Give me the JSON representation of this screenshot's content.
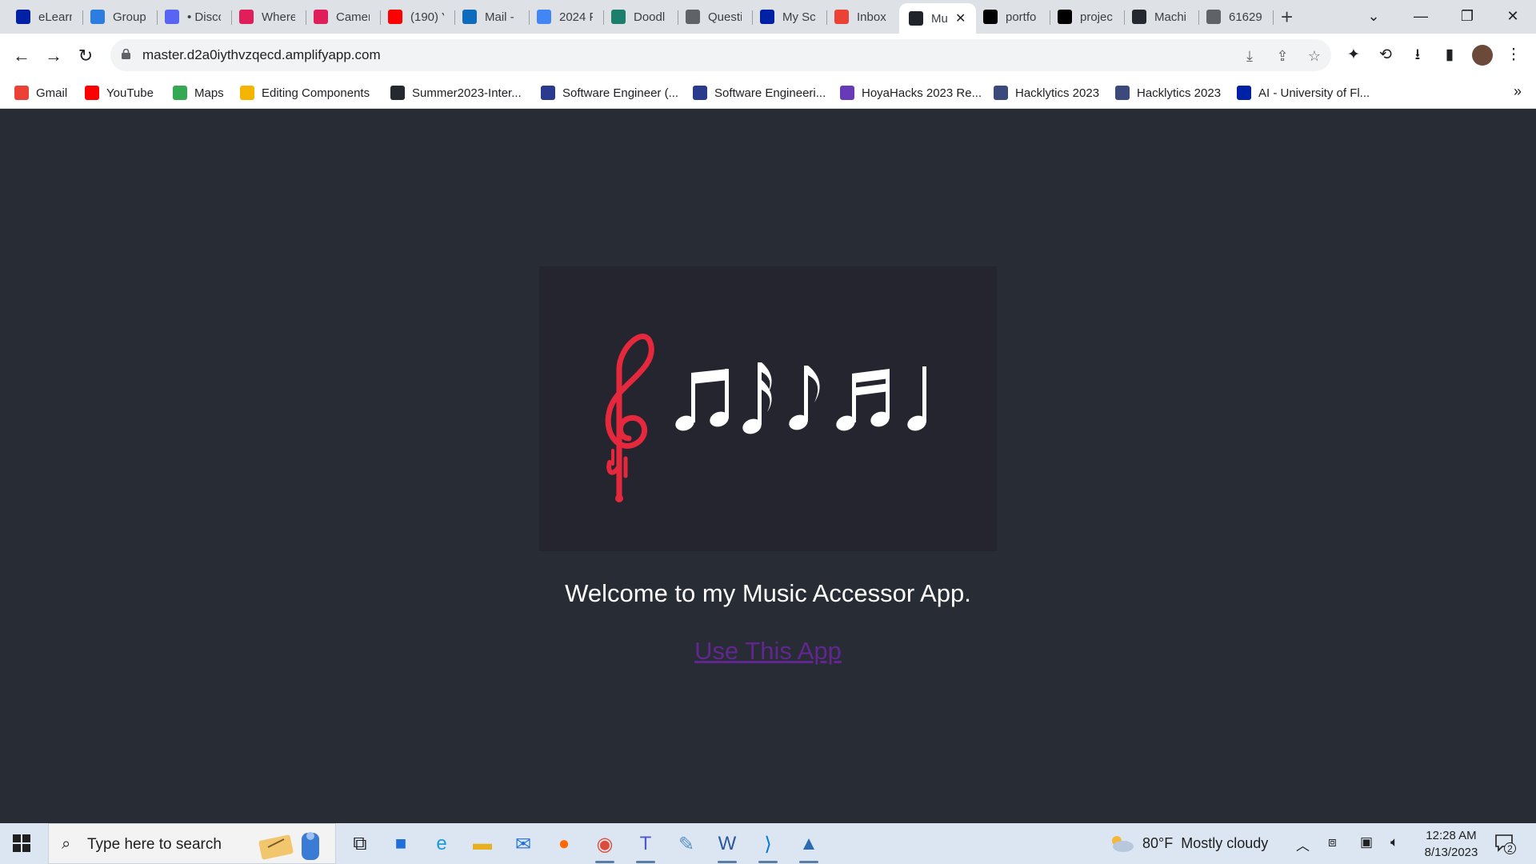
{
  "tabs": [
    {
      "title": "eLearn",
      "favicon": "uf-icon",
      "color": "#0021a5"
    },
    {
      "title": "Group",
      "favicon": "groupme-icon",
      "color": "#2c7de0"
    },
    {
      "title": "• Disco",
      "favicon": "discord-icon",
      "color": "#5865f2"
    },
    {
      "title": "Where",
      "favicon": "slack-icon",
      "color": "#e01e5a"
    },
    {
      "title": "Camer",
      "favicon": "slack-icon",
      "color": "#e01e5a"
    },
    {
      "title": "(190) Y",
      "favicon": "youtube-icon",
      "color": "#ff0000"
    },
    {
      "title": "Mail -",
      "favicon": "outlook-icon",
      "color": "#0f6cbd"
    },
    {
      "title": "2024 F",
      "favicon": "google-docs-icon",
      "color": "#4285f4"
    },
    {
      "title": "Doodl",
      "favicon": "doodle-icon",
      "color": "#1b7f6b"
    },
    {
      "title": "Questi",
      "favicon": "question-icon",
      "color": "#5f6368"
    },
    {
      "title": "My Sc",
      "favicon": "uf-icon",
      "color": "#0021a5"
    },
    {
      "title": "Inbox",
      "favicon": "gmail-icon",
      "color": "#ea4335"
    },
    {
      "title": "Mu",
      "favicon": "react-icon",
      "color": "#20232a",
      "active": true
    },
    {
      "title": "portfo",
      "favicon": "vercel-icon",
      "color": "#000000"
    },
    {
      "title": "projec",
      "favicon": "vercel-icon",
      "color": "#000000"
    },
    {
      "title": "Machi",
      "favicon": "github-icon",
      "color": "#24292f"
    },
    {
      "title": "61629",
      "favicon": "globe-icon",
      "color": "#5f6368"
    }
  ],
  "address_bar": {
    "url": "master.d2a0iythvzqecd.amplifyapp.com"
  },
  "bookmarks": [
    {
      "label": "Gmail",
      "icon": "gmail-icon",
      "color": "#ea4335"
    },
    {
      "label": "YouTube",
      "icon": "youtube-icon",
      "color": "#ff0000"
    },
    {
      "label": "Maps",
      "icon": "maps-icon",
      "color": "#34a853"
    },
    {
      "label": "Editing Components",
      "icon": "grid-icon",
      "color": "#f4b400"
    },
    {
      "label": "Summer2023-Inter...",
      "icon": "github-icon",
      "color": "#24292f"
    },
    {
      "label": "Software Engineer (...",
      "icon": "plane-icon",
      "color": "#2a3a8c"
    },
    {
      "label": "Software Engineeri...",
      "icon": "plane-icon",
      "color": "#2a3a8c"
    },
    {
      "label": "HoyaHacks 2023 Re...",
      "icon": "form-icon",
      "color": "#673ab7"
    },
    {
      "label": "Hacklytics 2023",
      "icon": "globe-icon",
      "color": "#3b4a7a"
    },
    {
      "label": "Hacklytics 2023",
      "icon": "globe-icon",
      "color": "#3b4a7a"
    },
    {
      "label": "AI - University of Fl...",
      "icon": "uf-icon",
      "color": "#0021a5"
    }
  ],
  "page": {
    "welcome": "Welcome to my Music Accessor App.",
    "link": "Use This App",
    "logo": "music-notes-logo",
    "background": "#282c34",
    "accent": "#e6283c"
  },
  "taskbar": {
    "search_placeholder": "Type here to search",
    "apps": [
      {
        "name": "task-view-icon",
        "glyph": "⧉"
      },
      {
        "name": "microsoft-store-icon",
        "glyph": "■"
      },
      {
        "name": "edge-icon",
        "glyph": "e"
      },
      {
        "name": "file-explorer-icon",
        "glyph": "▬"
      },
      {
        "name": "mail-icon",
        "glyph": "✉"
      },
      {
        "name": "firefox-icon",
        "glyph": "●"
      },
      {
        "name": "chrome-icon",
        "glyph": "◉",
        "running": true
      },
      {
        "name": "teams-icon",
        "glyph": "T",
        "running": true
      },
      {
        "name": "notepad-icon",
        "glyph": "✎"
      },
      {
        "name": "word-icon",
        "glyph": "W",
        "running": true
      },
      {
        "name": "vscode-icon",
        "glyph": "⟩",
        "running": true
      },
      {
        "name": "photos-icon",
        "glyph": "▲",
        "running": true
      }
    ],
    "weather": {
      "temp": "80°F",
      "condition": "Mostly cloudy"
    },
    "clock": {
      "time": "12:28 AM",
      "date": "8/13/2023"
    },
    "notifications": "2"
  }
}
